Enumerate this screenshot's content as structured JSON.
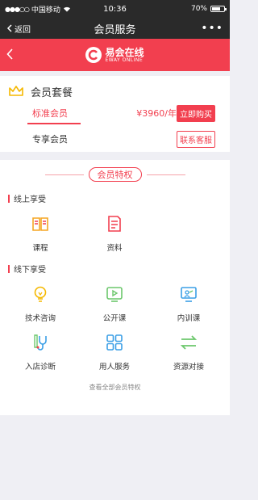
{
  "status": {
    "carrier": "中国移动",
    "time": "10:36",
    "battery": "70%",
    "battery_level": 0.7
  },
  "nav": {
    "back": "返回",
    "title": "会员服务",
    "more": "•••"
  },
  "logo": {
    "cn": "易会在线",
    "en": "EWAY ONLINE"
  },
  "membership": {
    "title": "会员套餐",
    "plans": [
      {
        "name": "标准会员",
        "price": "¥3960/年",
        "action": "立即购买"
      },
      {
        "name": "专享会员",
        "action": "联系客服"
      }
    ]
  },
  "benefits": {
    "title": "会员特权",
    "online": {
      "title": "线上享受",
      "items": [
        "课程",
        "资料"
      ]
    },
    "offline": {
      "title": "线下享受",
      "items": [
        "技术咨询",
        "公开课",
        "内训课",
        "入店诊断",
        "用人服务",
        "资源对接"
      ]
    },
    "view_all": "查看全部会员特权"
  },
  "colors": {
    "brand": "#f23f4f",
    "orange": "#f5a623",
    "green": "#6cc76c",
    "blue": "#3b9fe6",
    "yellow": "#f5b800"
  }
}
